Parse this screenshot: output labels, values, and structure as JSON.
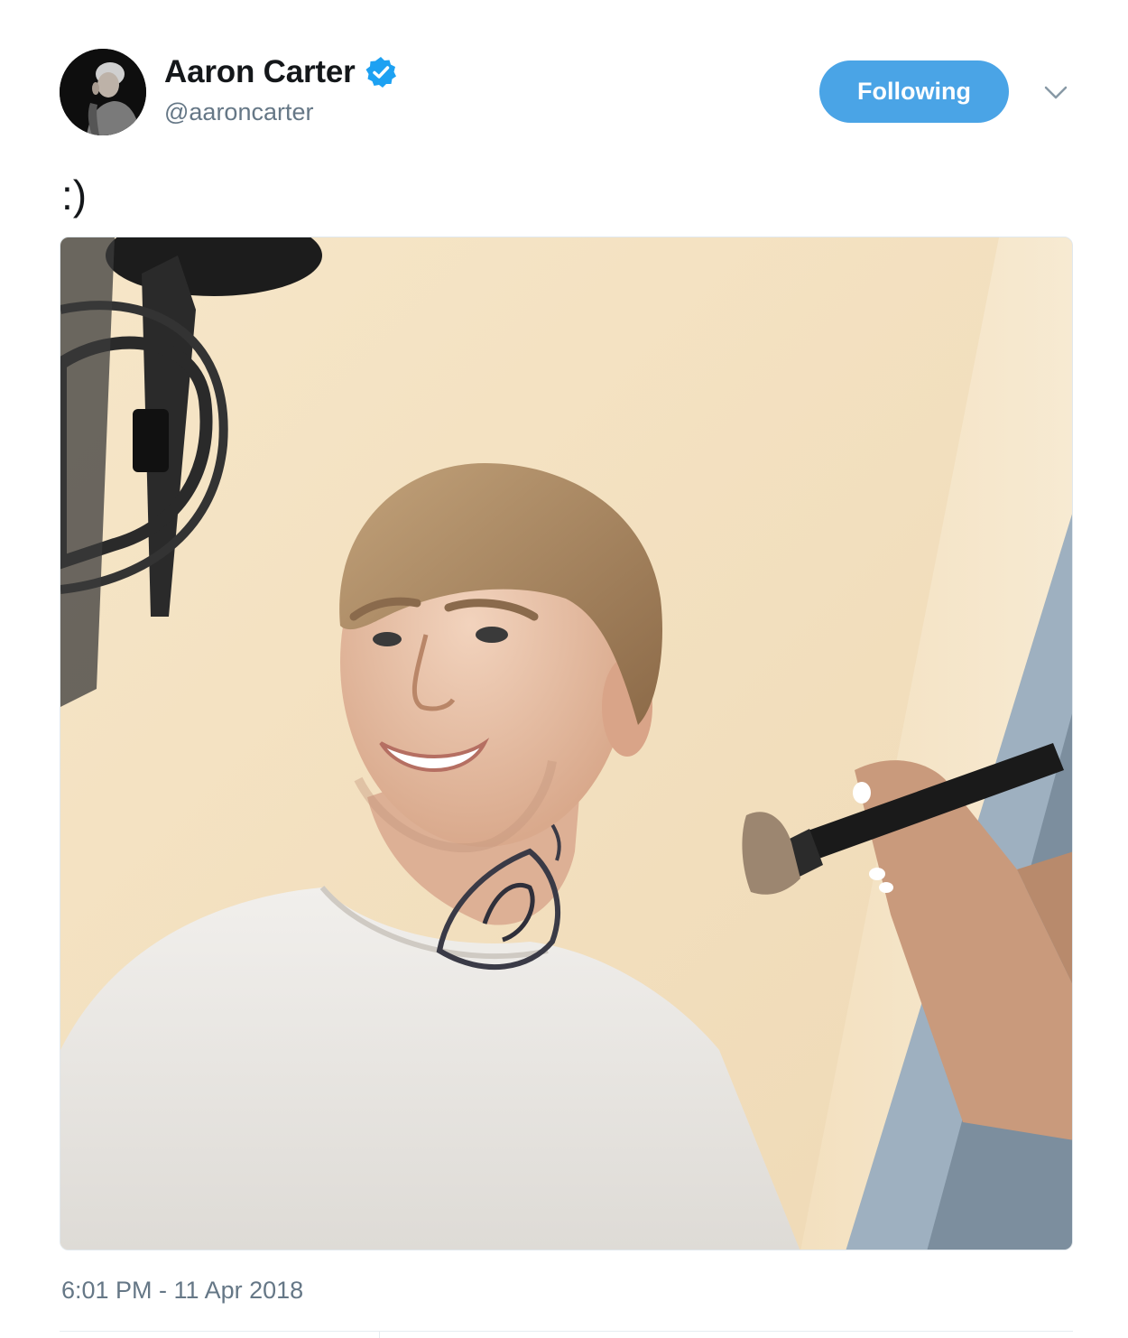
{
  "tweet": {
    "author": {
      "display_name": "Aaron Carter",
      "handle": "@aaroncarter",
      "verified": true,
      "avatar_icon": "profile-photo"
    },
    "follow_button_label": "Following",
    "menu_icon": "chevron-down-icon",
    "text": ":)",
    "media_description_icon": "photo",
    "timestamp": "6:01 PM - 11 Apr 2018"
  },
  "colors": {
    "follow_button": "#4aa4e6",
    "verified_badge": "#1da1f2",
    "secondary_text": "#657786",
    "primary_text": "#14171a"
  }
}
